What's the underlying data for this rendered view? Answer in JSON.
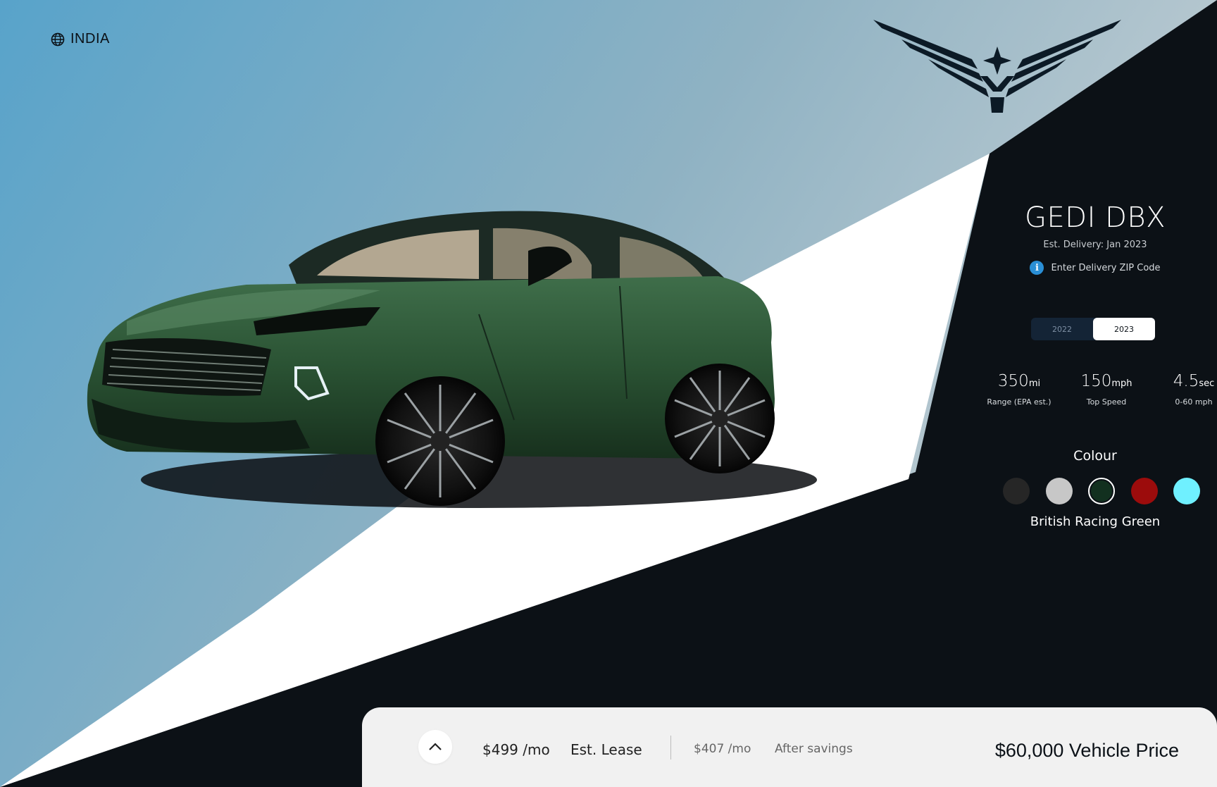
{
  "region": {
    "label": "INDIA",
    "icon": "globe-icon"
  },
  "brand": {
    "logo_icon": "winged-star-logo-icon"
  },
  "vehicle": {
    "model": "GEDI DBX",
    "delivery": "Est. Delivery: Jan 2023",
    "zip_prompt": "Enter Delivery ZIP Code",
    "zip_icon": "info-icon",
    "image_icon": "car-image"
  },
  "years": [
    {
      "label": "2022",
      "selected": false
    },
    {
      "label": "2023",
      "selected": true
    }
  ],
  "stats": [
    {
      "value": "350",
      "unit": "mi",
      "label": "Range (EPA est.)"
    },
    {
      "value": "150",
      "unit": "mph",
      "label": "Top Speed"
    },
    {
      "value": "4.5",
      "unit": "sec",
      "label": "0-60 mph"
    }
  ],
  "colour": {
    "title": "Colour",
    "selected_name": "British Racing Green",
    "swatches": [
      {
        "color": "#262626",
        "selected": false
      },
      {
        "color": "#c7c7c7",
        "selected": false
      },
      {
        "color": "#12301f",
        "selected": true
      },
      {
        "color": "#9c0c0c",
        "selected": false
      },
      {
        "color": "#6ff0ff",
        "selected": false
      }
    ]
  },
  "pricing": {
    "lease_price": "$499 /mo",
    "lease_label": "Est. Lease",
    "savings_price": "$407 /mo",
    "savings_label": "After savings",
    "vehicle_price": "$60,000 Vehicle Price",
    "expand_icon": "chevron-up-icon"
  }
}
